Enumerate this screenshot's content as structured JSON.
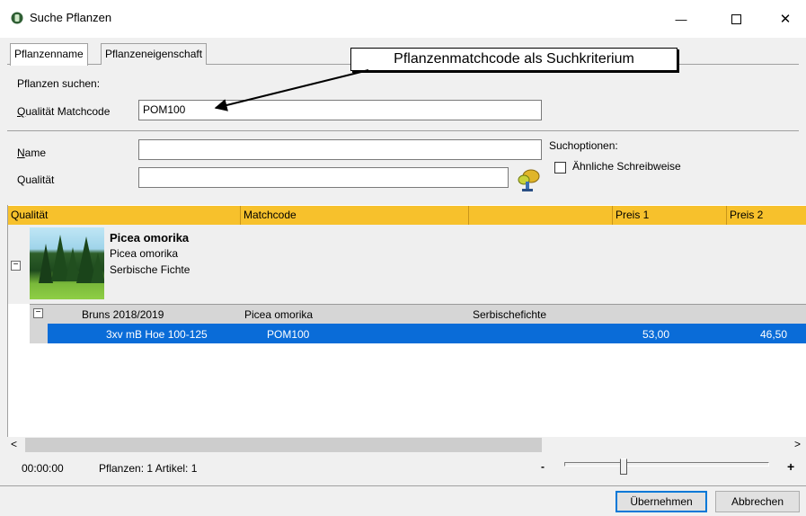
{
  "window": {
    "title": "Suche Pflanzen",
    "minimize_glyph": "—",
    "maximize_glyph": "☐",
    "close_glyph": "✕"
  },
  "tabs": [
    {
      "label": "Pflanzenname",
      "active": true
    },
    {
      "label": "Pflanzeneigenschaft",
      "active": false
    }
  ],
  "search": {
    "section_label": "Pflanzen suchen:",
    "matchcode_label_u": "Q",
    "matchcode_label_rest": "ualität Matchcode",
    "matchcode_value": "POM100",
    "name_label_u": "N",
    "name_label_rest": "ame",
    "name_value": "",
    "quality_label": "Qualität",
    "quality_value": ""
  },
  "callout": {
    "text": "Pflanzenmatchcode als Suchkriterium"
  },
  "options": {
    "title": "Suchoptionen:",
    "similar_spelling_label": "Ähnliche Schreibweise",
    "similar_spelling_checked": false
  },
  "grid": {
    "columns": [
      "Qualität",
      "Matchcode",
      "",
      "Preis 1",
      "Preis 2"
    ],
    "plant": {
      "name_bold": "Picea omorika",
      "name_latin": "Picea omorika",
      "name_german": "Serbische Fichte",
      "expander": "−"
    },
    "group": {
      "expander": "−",
      "catalog": "Bruns 2018/2019",
      "matchcode": "Picea omorika",
      "extra": "Serbischefichte"
    },
    "rows": [
      {
        "quality": "3xv mB Hoe 100-125",
        "matchcode": "POM100",
        "price1": "53,00",
        "price2": "46,50",
        "selected": true
      }
    ]
  },
  "scrollbar": {
    "left_arrow": "<",
    "right_arrow": ">"
  },
  "status": {
    "time": "00:00:00",
    "counts": "Pflanzen: 1  Artikel: 1",
    "zoom_minus": "-",
    "zoom_plus": "+",
    "zoom_level": 0.28
  },
  "buttons": {
    "apply": "Übernehmen",
    "cancel": "Abbrechen"
  },
  "colors": {
    "header_accent": "#f7c12c",
    "selection": "#0a6cd8"
  }
}
